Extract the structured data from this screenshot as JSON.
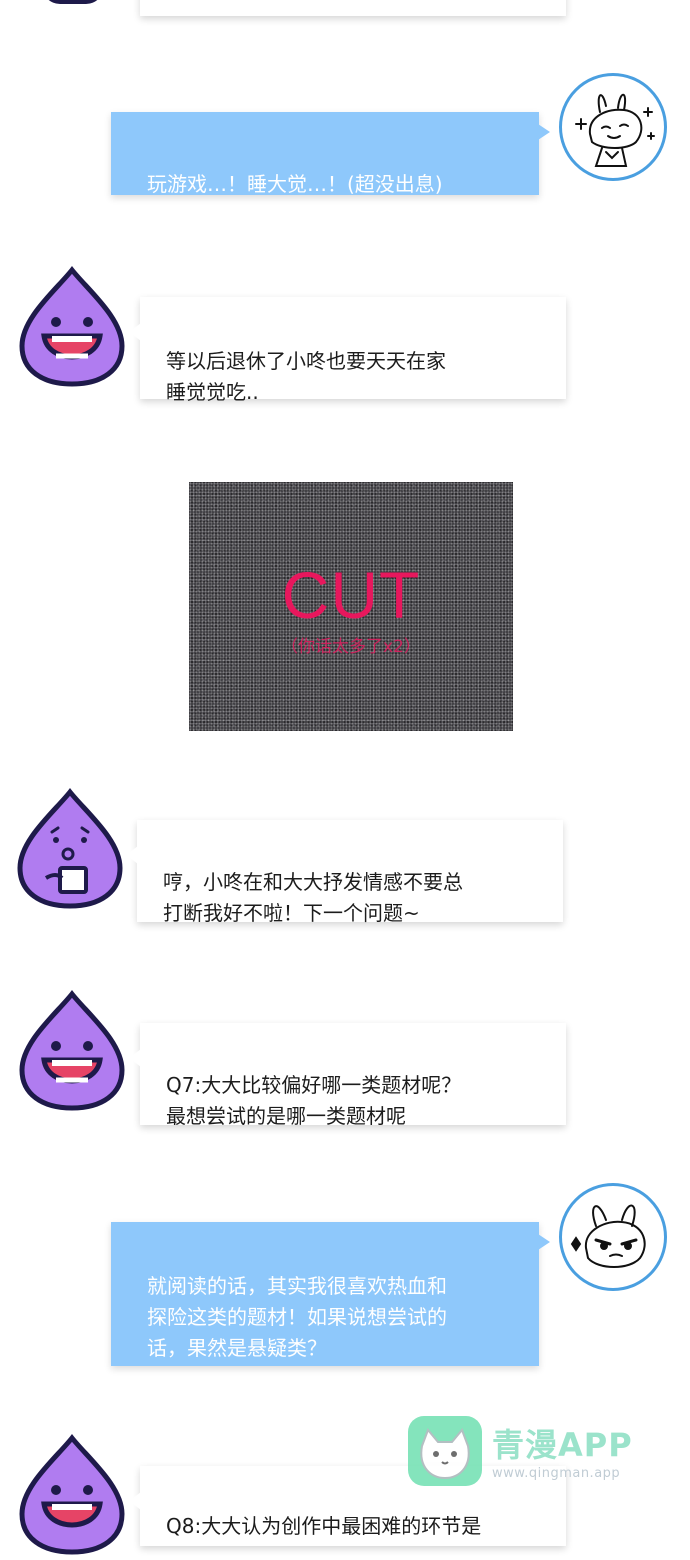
{
  "messages": [
    {
      "side": "right",
      "text": "玩游戏…！睡大觉…！(超没出息)"
    },
    {
      "side": "left",
      "text": "等以后退休了小咚也要天天在家\n睡觉觉吃.."
    },
    {
      "side": "left",
      "text": "哼，小咚在和大大抒发情感不要总\n打断我好不啦！下一个问题~"
    },
    {
      "side": "left",
      "text": "Q7:大大比较偏好哪一类题材呢？\n最想尝试的是哪一类题材呢"
    },
    {
      "side": "right",
      "text": "就阅读的话，其实我很喜欢热血和\n探险这类的题材！如果说想尝试的\n话，果然是悬疑类？"
    },
    {
      "side": "left",
      "text": "Q8:大大认为创作中最困难的环节是"
    }
  ],
  "cut_panel": {
    "title": "CUT",
    "subtitle": "（你话太多了x2）"
  },
  "watermark": {
    "title": "青漫APP",
    "url": "www.qingman.app"
  },
  "colors": {
    "blue_bubble": "#8ec8fb",
    "purple_mascot": "#b07cf0",
    "mascot_outline": "#1e1a4a",
    "mouth_red": "#e64466",
    "cut_red": "#e8175d",
    "avatar_ring": "#4a9fe0"
  },
  "icons": [
    "purple-drop-mascot-icon",
    "rabbit-avatar-icon",
    "cat-logo-icon"
  ]
}
